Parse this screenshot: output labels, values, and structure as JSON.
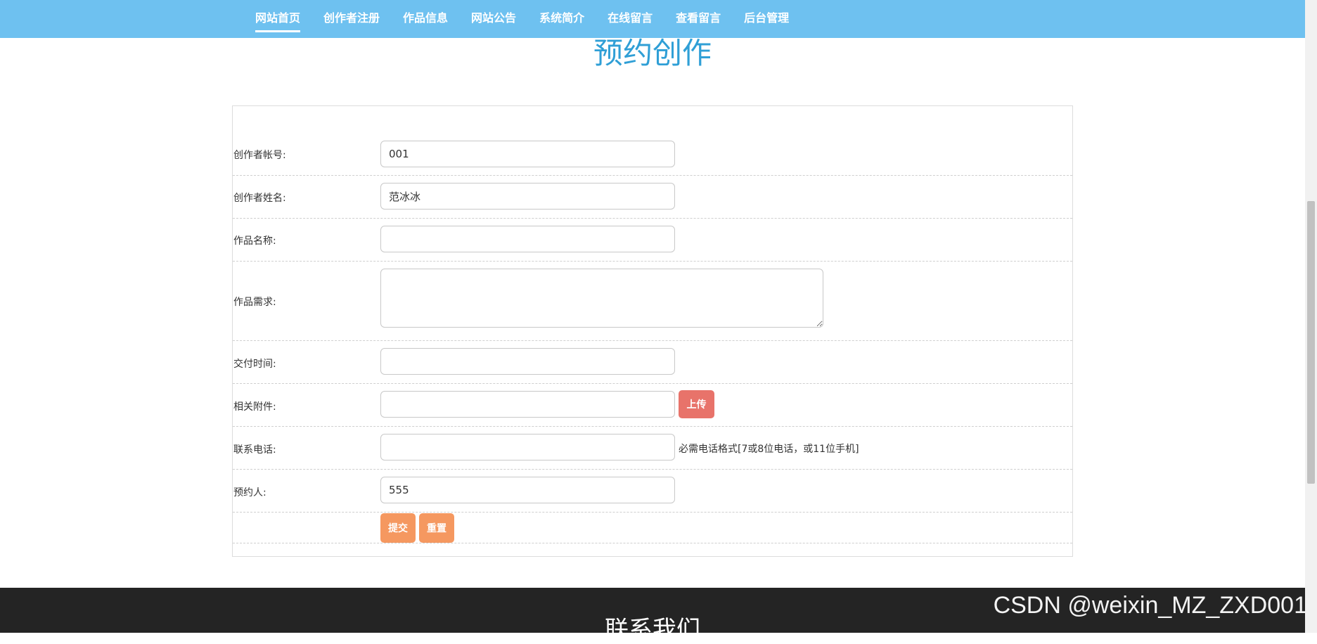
{
  "nav": {
    "items": [
      {
        "label": "网站首页",
        "active": true
      },
      {
        "label": "创作者注册"
      },
      {
        "label": "作品信息"
      },
      {
        "label": "网站公告"
      },
      {
        "label": "系统简介"
      },
      {
        "label": "在线留言"
      },
      {
        "label": "查看留言"
      },
      {
        "label": "后台管理"
      }
    ]
  },
  "page": {
    "title": "预约创作"
  },
  "form": {
    "creator_account": {
      "label": "创作者帐号:",
      "value": "001"
    },
    "creator_name": {
      "label": "创作者姓名:",
      "value": "范冰冰"
    },
    "work_name": {
      "label": "作品名称:",
      "value": ""
    },
    "work_requirement": {
      "label": "作品需求:",
      "value": ""
    },
    "delivery_time": {
      "label": "交付时间:",
      "value": ""
    },
    "attachment": {
      "label": "相关附件:",
      "value": "",
      "upload_label": "上传"
    },
    "phone": {
      "label": "联系电话:",
      "value": "",
      "hint": "必需电话格式[7或8位电话，或11位手机]"
    },
    "booker": {
      "label": "预约人:",
      "value": "555"
    },
    "submit_label": "提交",
    "reset_label": "重置"
  },
  "footer": {
    "title": "联系我们"
  },
  "watermark": "CSDN @weixin_MZ_ZXD001"
}
